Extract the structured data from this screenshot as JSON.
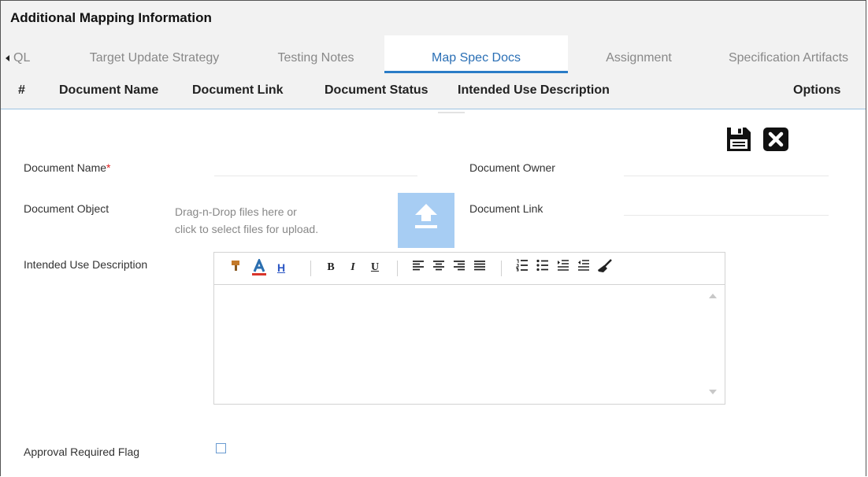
{
  "panel": {
    "title": "Additional Mapping Information"
  },
  "tabs": [
    {
      "label": "QL"
    },
    {
      "label": "Target Update Strategy"
    },
    {
      "label": "Testing Notes"
    },
    {
      "label": "Map Spec Docs",
      "active": true
    },
    {
      "label": "Assignment"
    },
    {
      "label": "Specification Artifacts"
    }
  ],
  "grid": {
    "columns": [
      "#",
      "Document Name",
      "Document Link",
      "Document Status",
      "Intended Use Description",
      "Options"
    ]
  },
  "form": {
    "document_name_label": "Document Name",
    "required_marker": "*",
    "document_owner_label": "Document Owner",
    "document_object_label": "Document Object",
    "drop_text_line1": "Drag-n-Drop files here or",
    "drop_text_line2": "click to select files for upload.",
    "document_link_label": "Document Link",
    "intended_use_label": "Intended Use Description",
    "approval_label": "Approval Required Flag"
  },
  "toolbar": {
    "underline_h": "H",
    "bold": "B",
    "italic": "I",
    "underline": "U"
  },
  "colors": {
    "accent": "#2a7cc7",
    "upload_button": "#a7cdf3",
    "required": "#e02020"
  },
  "icons": [
    "save-icon",
    "close-icon",
    "upload-icon",
    "paint-icon",
    "font-color-icon",
    "align-left-icon",
    "align-center-icon",
    "align-right-icon",
    "justify-icon",
    "numbered-list-icon",
    "bullet-list-icon",
    "indent-icon",
    "outdent-icon",
    "clear-format-icon"
  ]
}
